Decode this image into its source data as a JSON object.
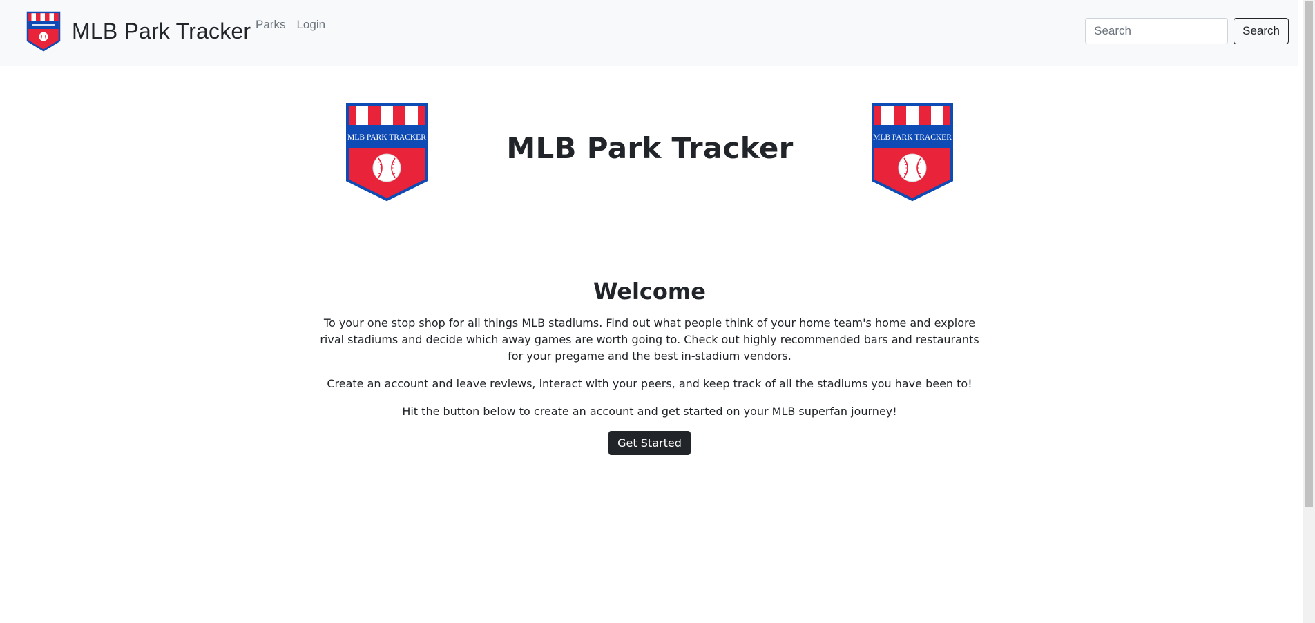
{
  "navbar": {
    "brand_title": "MLB Park Tracker",
    "links": [
      "Parks",
      "Login"
    ],
    "search": {
      "placeholder": "Search",
      "value": "",
      "button_label": "Search"
    }
  },
  "logo": {
    "text": "MLB PARK TRACKER",
    "colors": {
      "red": "#e8233a",
      "blue": "#0f4bb5",
      "white": "#ffffff"
    },
    "icon": "baseball-icon"
  },
  "hero": {
    "title": "MLB Park Tracker"
  },
  "welcome": {
    "heading": "Welcome",
    "paragraph_1": "To your one stop shop for all things MLB stadiums. Find out what people think of your home team's home and explore rival stadiums and decide which away games are worth going to. Check out highly recommended bars and restaurants for your pregame and the best in-stadium vendors.",
    "paragraph_2": "Create an account and leave reviews, interact with your peers, and keep track of all the stadiums you have been to!",
    "paragraph_3": "Hit the button below to create an account and get started on your MLB superfan journey!",
    "button_label": "Get Started"
  },
  "colors": {
    "navbar_bg": "#f8f9fa",
    "text_dark": "#212529",
    "link_muted": "#6c757d"
  }
}
